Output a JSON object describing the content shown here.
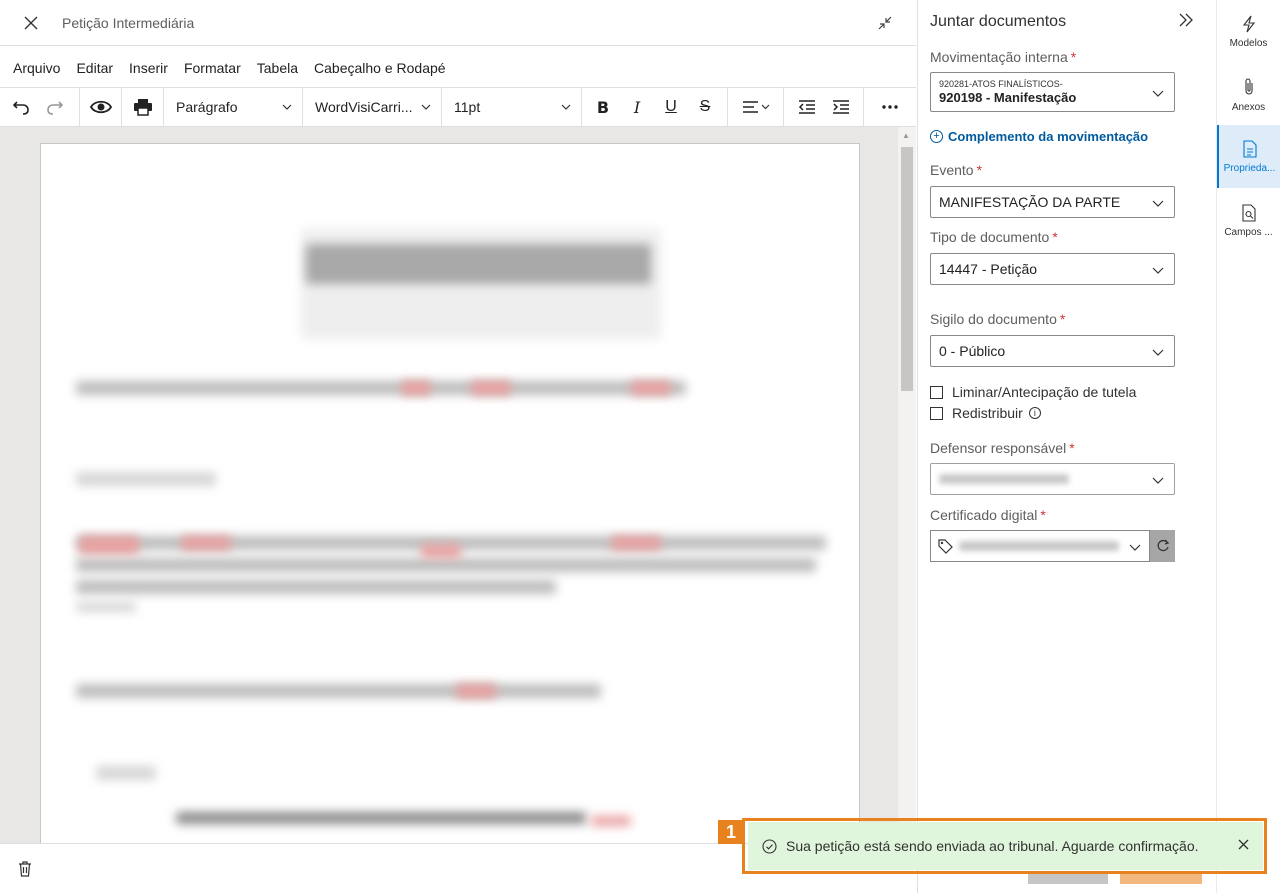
{
  "editor": {
    "title": "Petição Intermediária",
    "menu": [
      "Arquivo",
      "Editar",
      "Inserir",
      "Formatar",
      "Tabela",
      "Cabeçalho e Rodapé"
    ],
    "toolbar": {
      "paragraph_style": "Parágrafo",
      "font_family": "WordVisiCarri...",
      "font_size": "11pt"
    }
  },
  "panel": {
    "title": "Juntar documentos",
    "movimentacao": {
      "label": "Movimentação interna",
      "parent": "920281-ATOS FINALÍSTICOS-",
      "value": "920198 - Manifestação"
    },
    "complemento_label": "Complemento da movimentação",
    "evento": {
      "label": "Evento",
      "value": "MANIFESTAÇÃO DA PARTE"
    },
    "tipo_documento": {
      "label": "Tipo de documento",
      "value": "14447 - Petição"
    },
    "sigilo": {
      "label": "Sigilo do documento",
      "value": "0 - Público"
    },
    "checkboxes": {
      "liminar": "Liminar/Antecipação de tutela",
      "redistribuir": "Redistribuir"
    },
    "defensor": {
      "label": "Defensor responsável"
    },
    "certificado": {
      "label": "Certificado digital"
    }
  },
  "sidenav": [
    {
      "label": "Modelos",
      "icon": "lightning-icon"
    },
    {
      "label": "Anexos",
      "icon": "paperclip-icon"
    },
    {
      "label": "Proprieda...",
      "icon": "document-properties-icon",
      "active": true
    },
    {
      "label": "Campos ...",
      "icon": "document-search-icon"
    }
  ],
  "toast": {
    "marker": "1",
    "message": "Sua petição está sendo enviada ao tribunal. Aguarde confirmação."
  },
  "colors": {
    "accent": "#0078d4",
    "required": "#d13438",
    "toast_bg": "#dff6dd",
    "highlight": "#e8821e"
  }
}
